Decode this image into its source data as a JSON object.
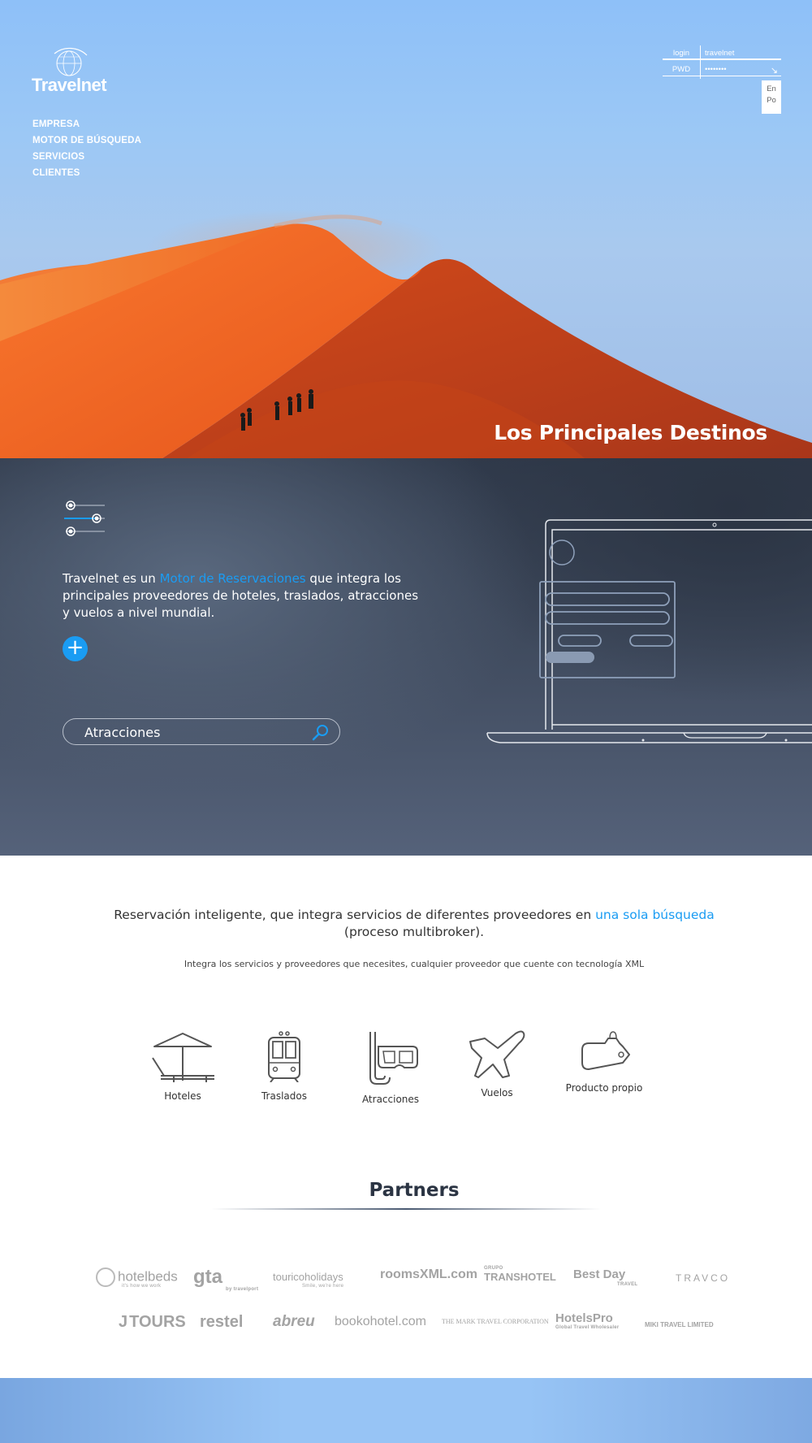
{
  "brand": {
    "name": "Travelnet"
  },
  "nav": {
    "items": [
      {
        "label": "EMPRESA"
      },
      {
        "label": "MOTOR DE BÚSQUEDA"
      },
      {
        "label": "SERVICIOS"
      },
      {
        "label": "CLIENTES"
      }
    ]
  },
  "login": {
    "user_label": "login",
    "user_value": "travelnet",
    "pwd_label": "PWD",
    "pwd_value": "••••••••",
    "go_icon": "arrow-down-right-icon"
  },
  "languages": [
    "En",
    "Po"
  ],
  "hero": {
    "title": "Los Principales Destinos"
  },
  "intro": {
    "before": "Travelnet es un ",
    "highlight": "Motor de Reservaciones",
    "after": " que integra los principales proveedores de hoteles, traslados, atracciones y vuelos a nivel mundial.",
    "plus_label": "+"
  },
  "search": {
    "value": "Atracciones",
    "icon": "search-icon"
  },
  "tagline": {
    "before": "Reservación inteligente, que integra servicios de diferentes proveedores en ",
    "highlight": "una sola búsqueda",
    "after": "(proceso multibroker)."
  },
  "subline": "Integra los servicios y proveedores que necesites, cualquier proveedor que cuente con tecnología XML",
  "services": [
    {
      "label": "Hoteles",
      "icon": "beach-umbrella-icon"
    },
    {
      "label": "Traslados",
      "icon": "train-icon"
    },
    {
      "label": "Atracciones",
      "icon": "snorkel-mask-icon"
    },
    {
      "label": "Vuelos",
      "icon": "airplane-icon"
    },
    {
      "label": "Producto propio",
      "icon": "tag-icon"
    }
  ],
  "partners": {
    "title": "Partners",
    "logos": [
      {
        "name": "hotelbeds",
        "sub": "it's how we work"
      },
      {
        "name": "gta",
        "sub": "by travelport"
      },
      {
        "name": "touricoholidays",
        "sub": "Smile, we're here"
      },
      {
        "name": "roomsXML.com",
        "sub": ""
      },
      {
        "name": "TRANSHOTEL",
        "sub": "GRUPO"
      },
      {
        "name": "Best Day",
        "sub": "TRAVEL"
      },
      {
        "name": "TRAVCO",
        "sub": ""
      },
      {
        "name": "TOURS",
        "sub": ""
      },
      {
        "name": "restel",
        "sub": ""
      },
      {
        "name": "abreu",
        "sub": ""
      },
      {
        "name": "bookohotel.com",
        "sub": ""
      },
      {
        "name": "THE MARK TRAVEL CORPORATION",
        "sub": ""
      },
      {
        "name": "HotelsPro",
        "sub": "Global Travel Wholesaler"
      },
      {
        "name": "MIKI TRAVEL LIMITED",
        "sub": ""
      }
    ]
  }
}
